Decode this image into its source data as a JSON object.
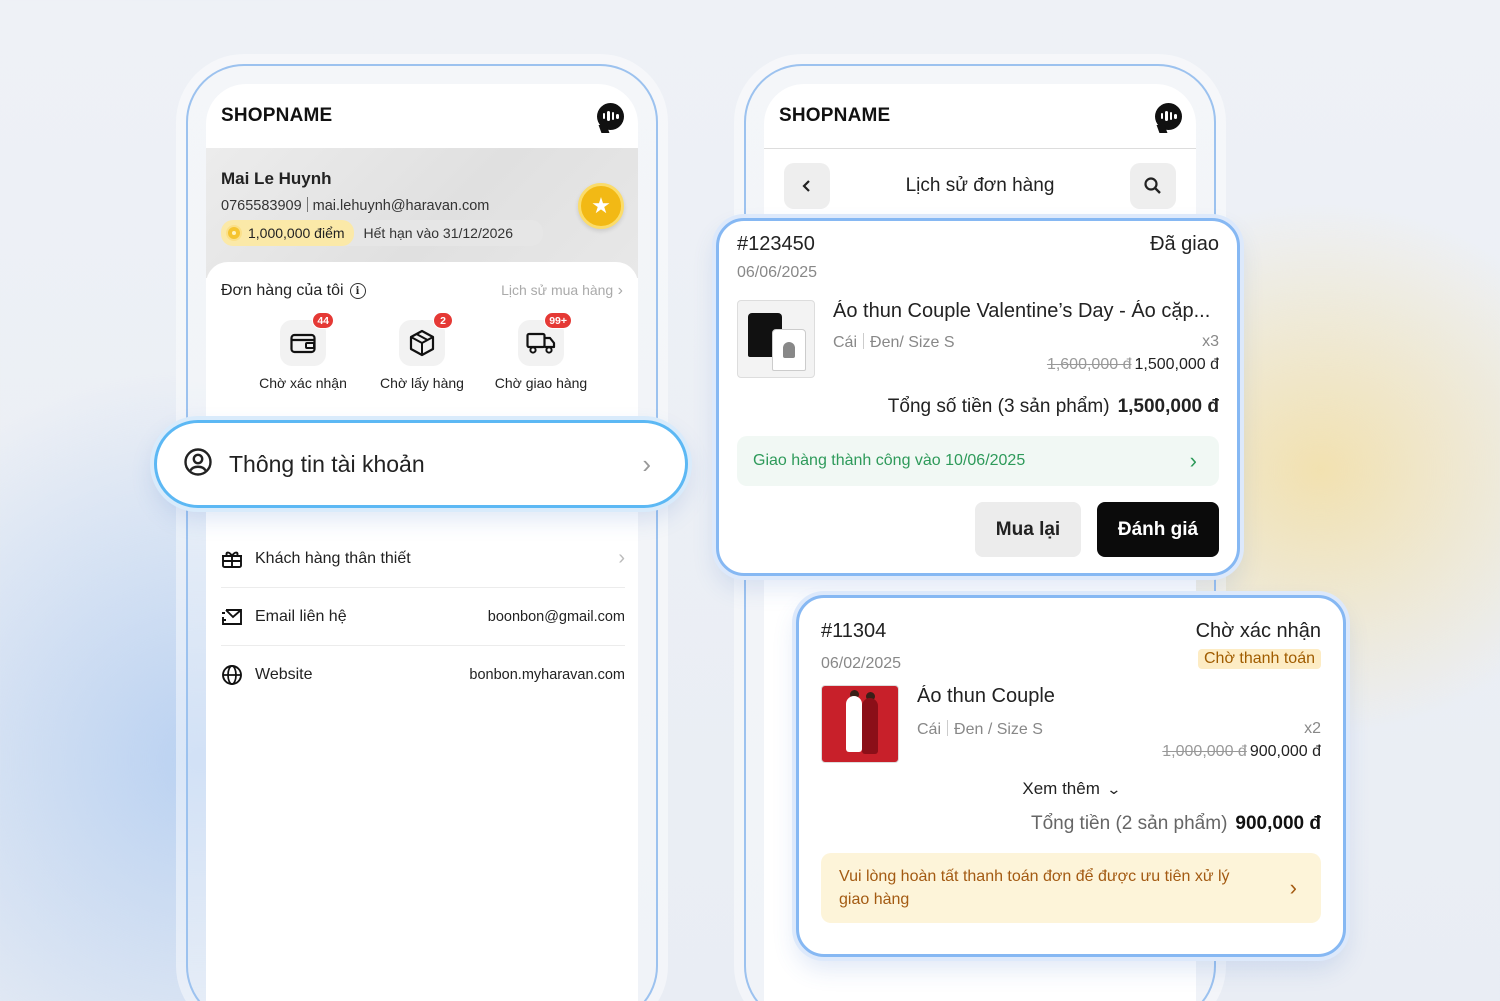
{
  "left_phone": {
    "shop_name": "SHOPNAME",
    "profile": {
      "name": "Mai Le Huynh",
      "phone": "0765583909",
      "email": "mai.lehuynh@haravan.com",
      "points": "1,000,000 điểm",
      "expiry": "Hết hạn vào 31/12/2026"
    },
    "orders": {
      "title": "Đơn hàng của tôi",
      "history_link": "Lịch sử mua hàng",
      "states": [
        {
          "label": "Chờ xác nhận",
          "badge": "44",
          "icon": "wallet-icon"
        },
        {
          "label": "Chờ lấy hàng",
          "badge": "2",
          "icon": "box-icon"
        },
        {
          "label": "Chờ giao hàng",
          "badge": "99+",
          "icon": "truck-icon"
        }
      ]
    },
    "menu": [
      {
        "label": "Khách hàng thân thiết",
        "value": "",
        "icon": "gift-icon"
      },
      {
        "label": "Email liên hệ",
        "value": "boonbon@gmail.com",
        "icon": "mail-icon"
      },
      {
        "label": "Website",
        "value": "bonbon.myharavan.com",
        "icon": "globe-icon"
      }
    ],
    "account_card": {
      "label": "Thông tin tài khoản",
      "icon": "user-circle-icon"
    }
  },
  "right_phone": {
    "shop_name": "SHOPNAME",
    "nav_title": "Lịch sử đơn hàng"
  },
  "order1": {
    "id": "#123450",
    "status": "Đã giao",
    "date": "06/06/2025",
    "product_name": "Áo thun Couple Valentine’s Day -  Áo cặp...",
    "unit": "Cái",
    "variant": "Đen/ Size S",
    "qty": "x3",
    "old_price": "1,600,000 đ",
    "price": "1,500,000 đ",
    "total_label": "Tổng số tiền (3 sản phẩm)",
    "total": "1,500,000 đ",
    "delivery_note": "Giao hàng thành công vào 10/06/2025",
    "rebuy": "Mua lại",
    "review": "Đánh giá"
  },
  "order2": {
    "id": "#11304",
    "status": "Chờ xác nhận",
    "payment_badge": "Chờ thanh toán",
    "date": "06/02/2025",
    "product_name": "Áo thun Couple",
    "unit": "Cái",
    "variant": "Đen / Size S",
    "qty": "x2",
    "old_price": "1,000,000 đ",
    "price": "900,000 đ",
    "see_more": "Xem thêm",
    "total_label": "Tổng tiền (2 sản phẩm)",
    "total": "900,000 đ",
    "warning": "Vui lòng hoàn tất thanh toán đơn để được ưu tiên xử lý giao hàng"
  }
}
